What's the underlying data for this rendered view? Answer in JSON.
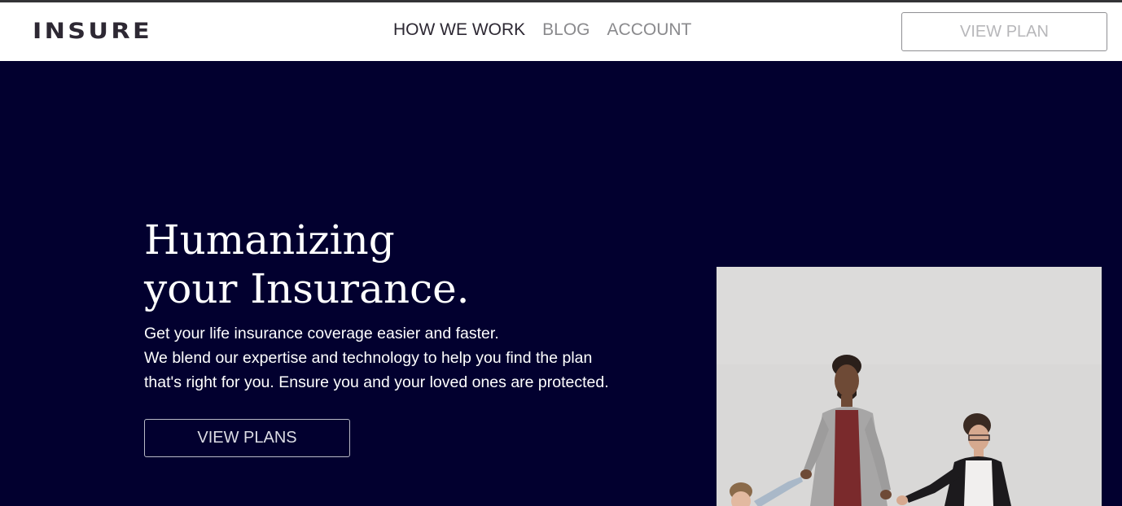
{
  "header": {
    "logo": "INSURE",
    "nav": [
      {
        "label": "HOW WE WORK",
        "active": true
      },
      {
        "label": "BLOG",
        "active": false
      },
      {
        "label": "ACCOUNT",
        "active": false
      }
    ],
    "cta_label": "VIEW PLAN"
  },
  "hero": {
    "headline_line1": "Humanizing",
    "headline_line2": "your Insurance.",
    "description_line1": "Get your life insurance coverage easier and faster.",
    "description_line2": "We blend our expertise and technology to help you find the plan",
    "description_line3": "that's right for you. Ensure you and your loved ones are protected.",
    "cta_label": "VIEW PLANS",
    "image_subject": "family-holding-hands-photo"
  },
  "colors": {
    "hero_background": "#02002f",
    "logo_text": "#2d2833",
    "nav_active": "#2d2833",
    "nav_inactive": "#8a8a8d"
  }
}
